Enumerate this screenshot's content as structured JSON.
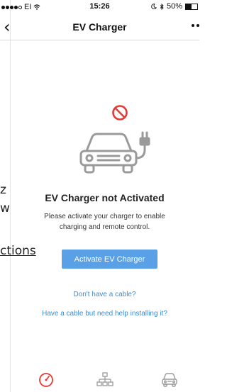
{
  "status_bar": {
    "carrier": "EI",
    "time": "15:26",
    "battery": "50%"
  },
  "nav": {
    "back_symbol": "‹",
    "title": "EV Charger"
  },
  "background_page": {
    "fragments": [
      "z",
      "w",
      "ctions"
    ]
  },
  "main": {
    "heading": "EV Charger not Activated",
    "description_line1": "Please activate your charger to enable",
    "description_line2": "charging and remote control.",
    "activate_button": "Activate EV Charger",
    "link_no_cable": "Don't have a cable?",
    "link_install_help": "Have a cable but need help installing it?"
  },
  "icons": {
    "prohibited": "prohibited-icon",
    "car_charger": "car-charger-icon",
    "tab1": "speedometer-icon",
    "tab2": "network-icon",
    "tab3": "car-icon"
  },
  "colors": {
    "accent": "#5aa0e6",
    "link": "#3b8bd6",
    "alert": "#e53935",
    "icon_gray": "#9a9a9a"
  }
}
